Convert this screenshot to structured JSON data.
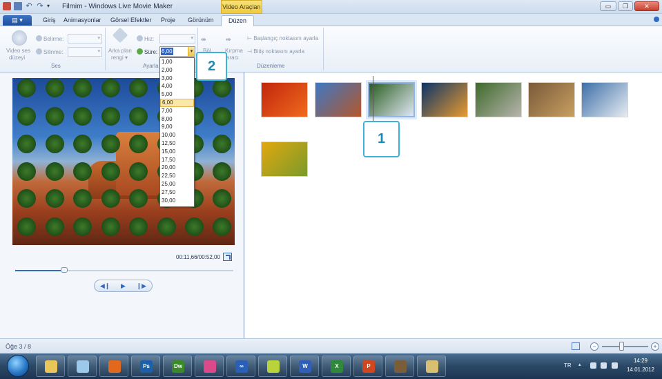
{
  "titlebar": {
    "title": "Filmim - Windows Live Movie Maker",
    "contextual_tab": "Video Araçları",
    "minimize": "▭",
    "maximize": "❐",
    "close": "✕"
  },
  "tabs": {
    "file_button": "▤ ▾",
    "items": [
      "Giriş",
      "Animasyonlar",
      "Görsel Efektler",
      "Proje",
      "Görünüm",
      "Düzen"
    ],
    "active": "Düzen"
  },
  "ribbon": {
    "ses_group": {
      "video_volume_line1": "Video ses",
      "video_volume_line2": "düzeyi",
      "fade_in_label": "Belirme:",
      "fade_out_label": "Silinme:",
      "group_label": "Ses"
    },
    "ayarla_group": {
      "bg_color_line1": "Arka plan",
      "bg_color_line2": "rengi ▾",
      "speed_label": "Hız:",
      "duration_label": "Süre:",
      "duration_value": "6,00",
      "group_label": "Ayarla"
    },
    "duzenleme_group": {
      "split_label": "Böl",
      "trim_line1": "Kırpma",
      "trim_line2": "aracı",
      "set_start": "Başlangıç noktasını ayarla",
      "set_end": "Bitiş noktasını ayarla",
      "group_label": "Düzenleme"
    }
  },
  "duration_dropdown": {
    "options": [
      "1,00",
      "2,00",
      "3,00",
      "4,00",
      "5,00",
      "6,00",
      "7,00",
      "8,00",
      "9,00",
      "10,00",
      "12,50",
      "15,00",
      "17,50",
      "20,00",
      "22,50",
      "25,00",
      "27,50",
      "30,00"
    ],
    "selected": "6,00"
  },
  "callouts": {
    "one": "1",
    "two": "2"
  },
  "preview": {
    "timecode": "00:11,66/00:52,00",
    "progress": 0.224,
    "prev_frame": "◀❙",
    "play": "▶",
    "next_frame": "❙▶"
  },
  "storyboard": {
    "clips": [
      {
        "name": "flower-red",
        "colors": [
          "#c2260d",
          "#f06a1c"
        ]
      },
      {
        "name": "desert",
        "colors": [
          "#3c78c4",
          "#b4562a"
        ]
      },
      {
        "name": "hydrangea",
        "colors": [
          "#2a5d1e",
          "#dfe7f5"
        ],
        "selected": true
      },
      {
        "name": "jellyfish",
        "colors": [
          "#0b3468",
          "#e89a2e"
        ]
      },
      {
        "name": "koala",
        "colors": [
          "#3f6a2c",
          "#b7b4ad"
        ]
      },
      {
        "name": "lighthouse",
        "colors": [
          "#7a5a3a",
          "#c7a060"
        ]
      },
      {
        "name": "penguins",
        "colors": [
          "#3d6fa8",
          "#e7ecf1"
        ]
      },
      {
        "name": "tulips",
        "colors": [
          "#e2a70f",
          "#7a9b2a"
        ]
      }
    ]
  },
  "status": {
    "item_count": "Öğe 3 / 8"
  },
  "taskbar": {
    "apps": [
      {
        "name": "explorer",
        "glyph": "",
        "color": "#e9c65a"
      },
      {
        "name": "windows-live",
        "glyph": "",
        "color": "#9cc9e9"
      },
      {
        "name": "firefox",
        "glyph": "",
        "color": "#e2681d"
      },
      {
        "name": "photoshop",
        "glyph": "Ps",
        "color": "#1d5fa8"
      },
      {
        "name": "dreamweaver",
        "glyph": "Dw",
        "color": "#3a8a2a"
      },
      {
        "name": "paint-net",
        "glyph": "",
        "color": "#d84a8a"
      },
      {
        "name": "messenger",
        "glyph": "∞",
        "color": "#2a5fb8"
      },
      {
        "name": "snipping",
        "glyph": "",
        "color": "#b9d33a"
      },
      {
        "name": "word",
        "glyph": "W",
        "color": "#2f5fb8"
      },
      {
        "name": "excel",
        "glyph": "X",
        "color": "#2e8a3a"
      },
      {
        "name": "powerpoint",
        "glyph": "P",
        "color": "#d0471f"
      },
      {
        "name": "movie-maker",
        "glyph": "",
        "color": "#7a5e3a"
      },
      {
        "name": "paint",
        "glyph": "",
        "color": "#d9c070"
      }
    ],
    "language": "TR",
    "time": "14:29",
    "date": "14.01.2012"
  }
}
